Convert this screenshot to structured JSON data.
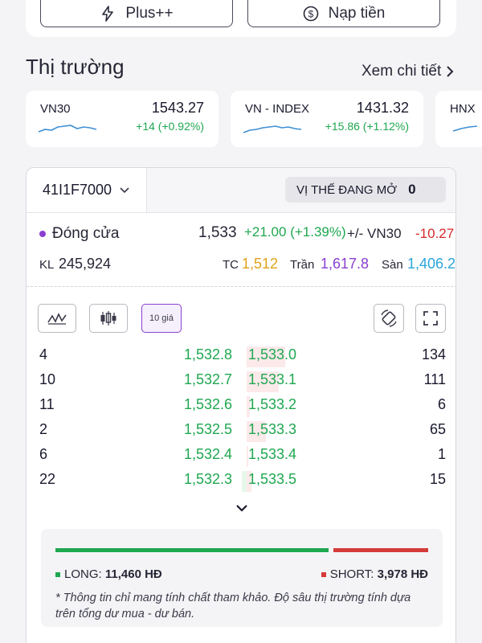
{
  "top_actions": {
    "plus_label": "Plus++",
    "nap_label": "Nạp tiền"
  },
  "market": {
    "title": "Thị trường",
    "more_label": "Xem chi tiết",
    "indices": [
      {
        "name": "VN30",
        "value": "1543.27",
        "change": "+14 (+0.92%)"
      },
      {
        "name": "VN - INDEX",
        "value": "1431.32",
        "change": "+15.86 (+1.12%)"
      },
      {
        "name": "HNX"
      }
    ]
  },
  "contract": {
    "code": "41I1F7000",
    "open_position_label": "VỊ THẾ ĐANG MỞ",
    "open_position_value": "0",
    "close_label": "Đóng cửa",
    "close_price": "1,533",
    "close_change": "+21.00 (+1.39%)",
    "basis_label": "+/- VN30",
    "basis_value": "-10.27",
    "volume_label": "KL",
    "volume_value": "245,924",
    "ref_label": "TC",
    "ref_value": "1,512",
    "ceil_label": "Trần",
    "ceil_value": "1,617.8",
    "floor_label": "Sàn",
    "floor_value": "1,406.2"
  },
  "toolbar": {
    "depth_label": "10 giá"
  },
  "orderbook": [
    {
      "bid_vol": "4",
      "bid": "1,532.8",
      "ask": "1,533.0",
      "ask_vol": "134"
    },
    {
      "bid_vol": "10",
      "bid": "1,532.7",
      "ask": "1,533.1",
      "ask_vol": "111"
    },
    {
      "bid_vol": "11",
      "bid": "1,532.6",
      "ask": "1,533.2",
      "ask_vol": "6"
    },
    {
      "bid_vol": "2",
      "bid": "1,532.5",
      "ask": "1,533.3",
      "ask_vol": "65"
    },
    {
      "bid_vol": "6",
      "bid": "1,532.4",
      "ask": "1,533.4",
      "ask_vol": "1"
    },
    {
      "bid_vol": "22",
      "bid": "1,532.3",
      "ask": "1,533.5",
      "ask_vol": "15"
    }
  ],
  "long_short": {
    "long_label": "LONG:",
    "long_value": "11,460 HĐ",
    "short_label": "SHORT:",
    "short_value": "3,978 HĐ",
    "note": "* Thông tin chỉ mang tính chất tham khảo. Độ sâu thị trường tính dựa trên tổng dư mua - dư bán."
  },
  "colors": {
    "up": "#1fa750",
    "down": "#d62b2b",
    "ref": "#e0a21a",
    "ceil": "#8a3fd1",
    "floor": "#2aa5d8"
  }
}
